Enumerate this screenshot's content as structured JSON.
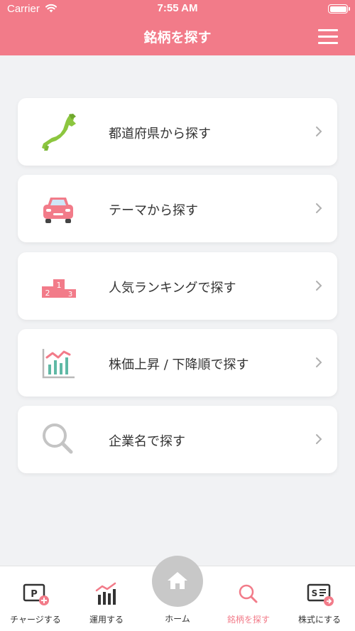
{
  "status_bar": {
    "carrier": "Carrier",
    "time": "7:55 AM"
  },
  "header": {
    "title": "銘柄を探す",
    "menu_icon": "hamburger-menu-icon"
  },
  "colors": {
    "brand": "#f27b89",
    "background": "#f1f2f4",
    "icon_gray": "#b9b9b9",
    "map_green": "#8cc63f"
  },
  "menu": {
    "items": [
      {
        "label": "都道府県から探す",
        "icon": "japan-map-icon"
      },
      {
        "label": "テーマから探す",
        "icon": "car-icon"
      },
      {
        "label": "人気ランキングで探す",
        "icon": "podium-icon"
      },
      {
        "label": "株価上昇 / 下降順で探す",
        "icon": "stock-chart-icon"
      },
      {
        "label": "企業名で探す",
        "icon": "search-icon"
      }
    ]
  },
  "podium": {
    "first": "1",
    "second": "2",
    "third": "3"
  },
  "tabbar": {
    "items": [
      {
        "label": "チャージする",
        "icon": "point-charge-icon"
      },
      {
        "label": "運用する",
        "icon": "chart-icon"
      },
      {
        "label": "ホーム",
        "icon": "home-icon"
      },
      {
        "label": "銘柄を探す",
        "icon": "search-icon",
        "active": true
      },
      {
        "label": "株式にする",
        "icon": "stock-certificate-icon"
      }
    ]
  },
  "tab_icon_text": {
    "charge": "P",
    "stock": "S"
  }
}
